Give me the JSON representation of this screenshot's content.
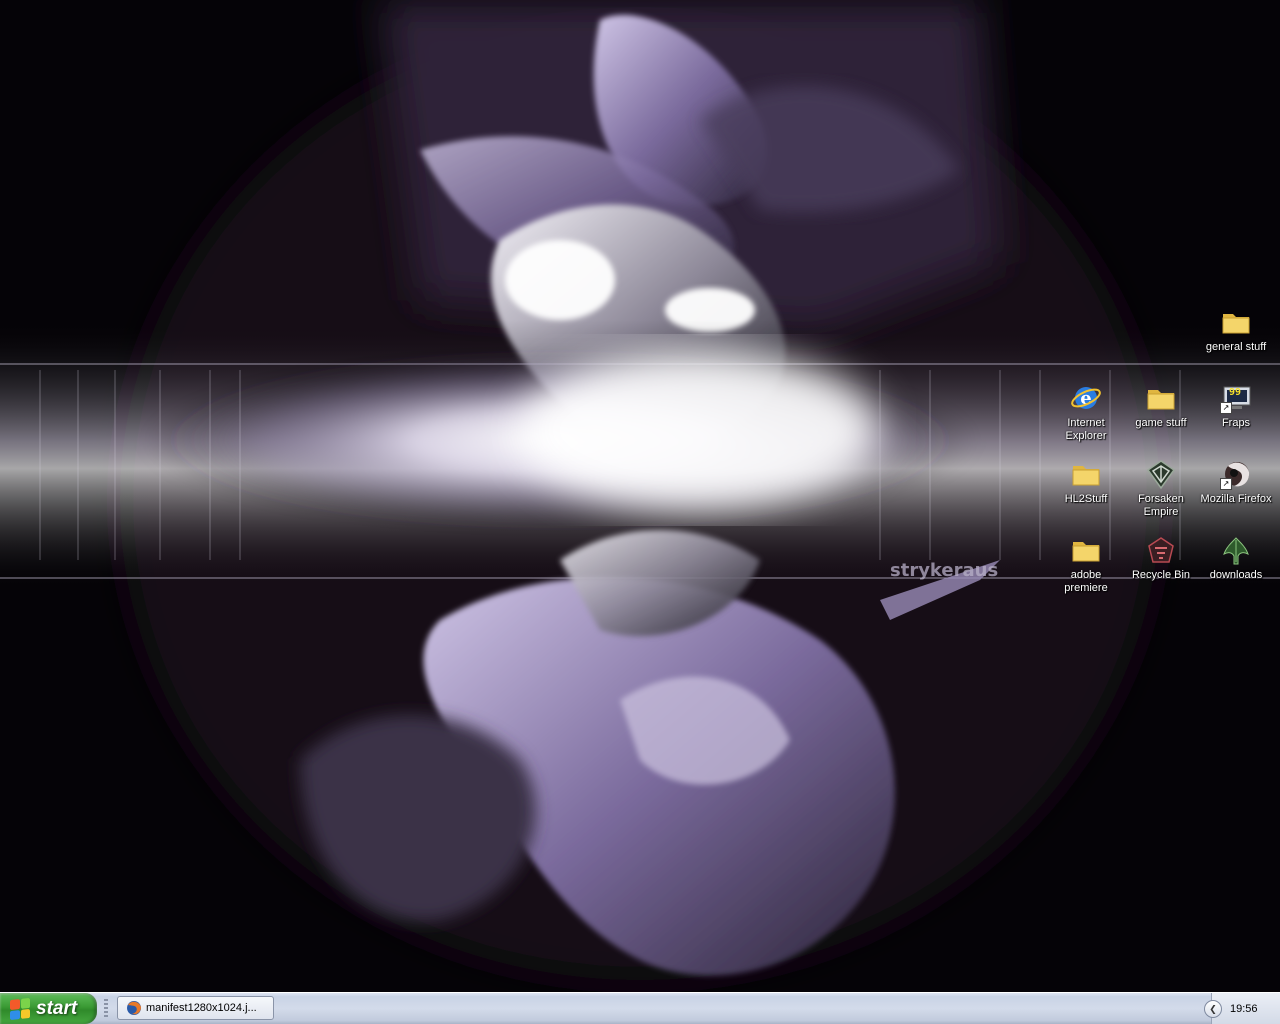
{
  "desktop": {
    "icons": [
      {
        "label": "general stuff",
        "icon": "folder-icon"
      },
      {
        "label": "Internet Explorer",
        "icon": "internet-explorer-icon"
      },
      {
        "label": "game stuff",
        "icon": "folder-icon"
      },
      {
        "label": "Fraps",
        "icon": "fraps-icon",
        "badge": "99"
      },
      {
        "label": "HL2Stuff",
        "icon": "folder-icon"
      },
      {
        "label": "Forsaken Empire",
        "icon": "forsaken-empire-icon"
      },
      {
        "label": "Mozilla Firefox",
        "icon": "firefox-icon"
      },
      {
        "label": "adobe premiere",
        "icon": "folder-icon"
      },
      {
        "label": "Recycle Bin",
        "icon": "recycle-bin-icon"
      },
      {
        "label": "downloads",
        "icon": "downloads-icon"
      }
    ]
  },
  "wallpaper": {
    "signature": "strykeraus",
    "accent": "#8a7aa8"
  },
  "taskbar": {
    "start_label": "start",
    "tasks": [
      {
        "label": "manifest1280x1024.j...",
        "icon": "firefox-icon"
      }
    ],
    "clock": "19:56"
  },
  "colors": {
    "taskbar": "#d3dbea",
    "start_green": "#3a9a34",
    "folder_yellow": "#f4d56a"
  }
}
